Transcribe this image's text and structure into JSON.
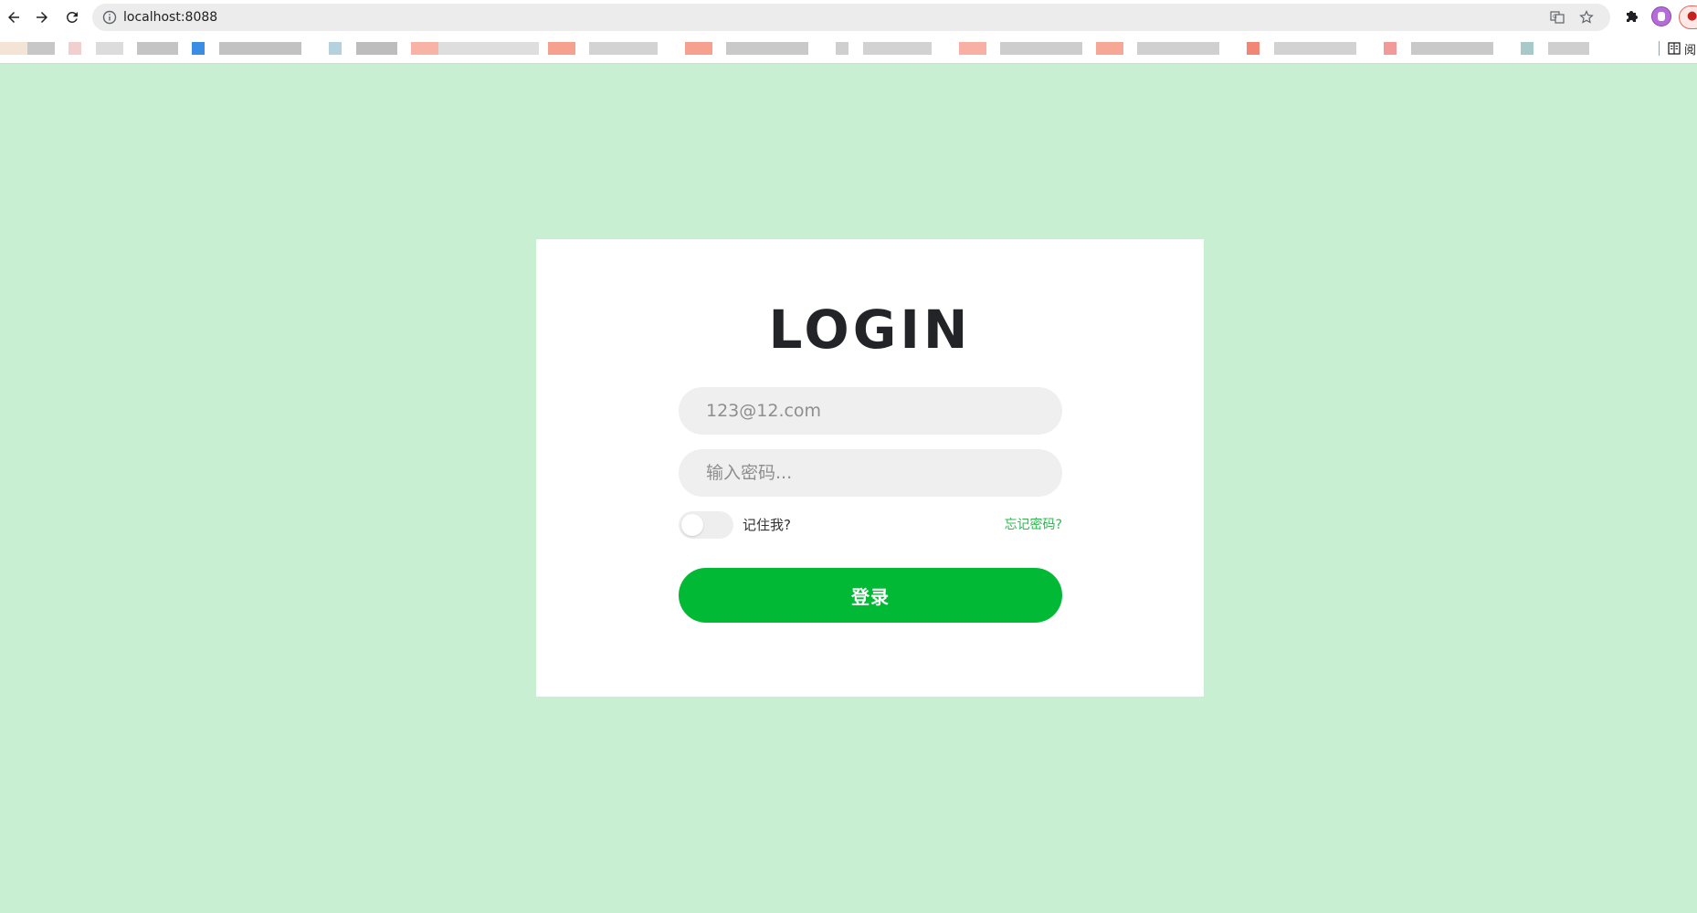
{
  "browser": {
    "url": "localhost:8088",
    "reading_list_label": "阅"
  },
  "colors": {
    "page_background": "#c9efd2",
    "card_background": "#ffffff",
    "primary_button": "#02b936",
    "link_color": "#2db84d",
    "input_background": "#efefef"
  },
  "login": {
    "title": "LOGIN",
    "email_placeholder": "123@12.com",
    "password_placeholder": "输入密码...",
    "remember_label": "记住我?",
    "remember_on": false,
    "forgot_label": "忘记密码?",
    "submit_label": "登录"
  }
}
